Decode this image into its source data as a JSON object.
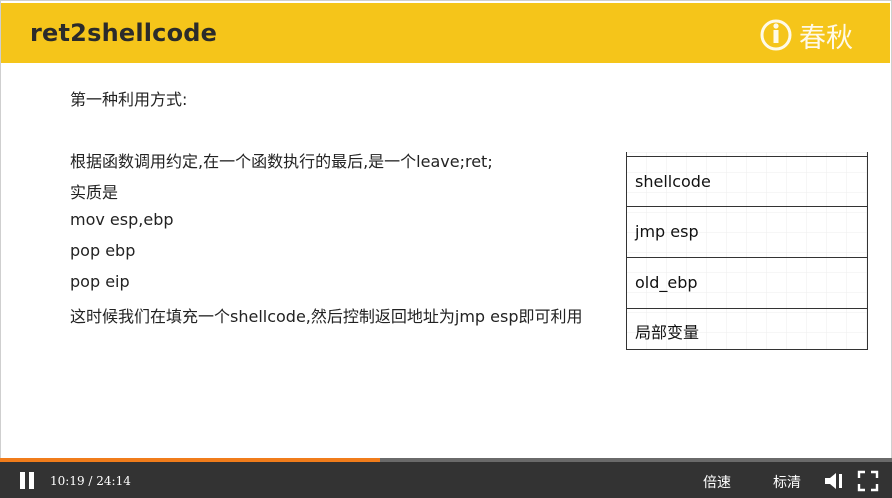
{
  "slide": {
    "title": "ret2shellcode",
    "logo_text": "春秋",
    "lines": [
      "第一种利用方式:",
      "根据函数调用约定,在一个函数执行的最后,是一个leave;ret;",
      "实质是",
      "mov esp,ebp",
      "pop ebp",
      "pop eip",
      "这时候我们在填充一个shellcode,然后控制返回地址为jmp esp即可利用"
    ],
    "stack": [
      "shellcode",
      "jmp esp",
      "old_ebp",
      "局部变量"
    ]
  },
  "player": {
    "time": "10:19 / 24:14",
    "progress": 0.4257,
    "speed_label": "倍速",
    "quality_label": "标清",
    "icons": {
      "play": "pause-icon",
      "volume": "volume-icon",
      "fullscreen": "fullscreen-icon"
    }
  },
  "colors": {
    "title_bar": "#f5c51a",
    "progress": "#f07c1b",
    "player_bg": "#333333"
  }
}
